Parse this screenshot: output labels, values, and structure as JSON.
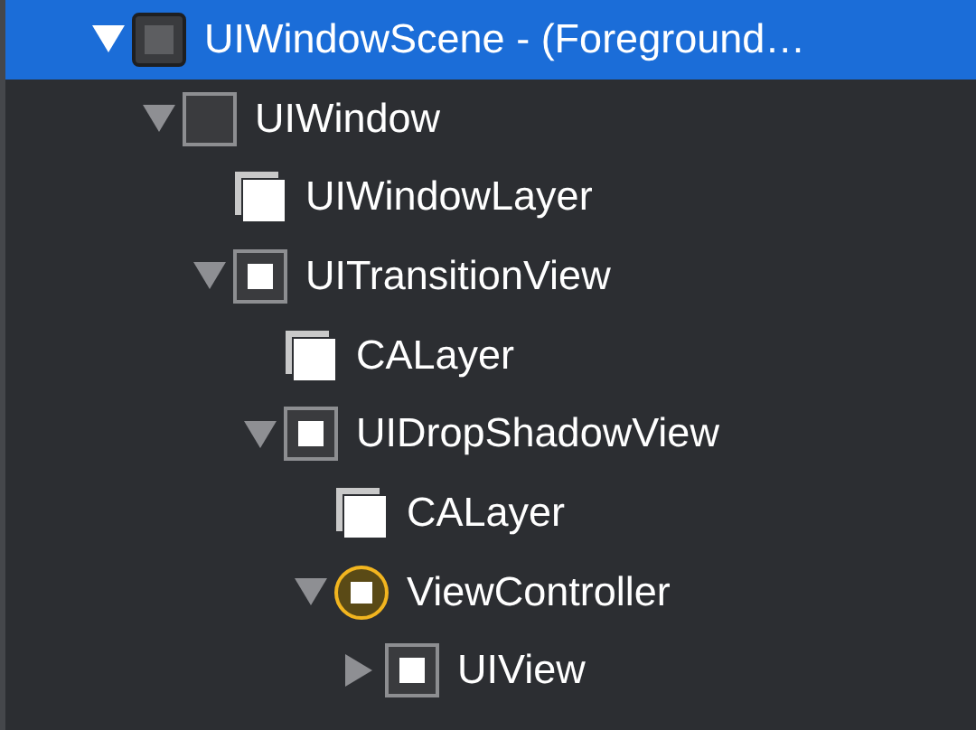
{
  "tree": [
    {
      "label": "UIWindowScene - (Foreground…",
      "kind": "scene",
      "expanded": true,
      "selected": true,
      "children": [
        {
          "label": "UIWindow",
          "kind": "window",
          "expanded": true,
          "selected": false,
          "children": [
            {
              "label": "UIWindowLayer",
              "kind": "layer",
              "selected": false
            },
            {
              "label": "UITransitionView",
              "kind": "view",
              "expanded": true,
              "selected": false,
              "children": [
                {
                  "label": "CALayer",
                  "kind": "layer",
                  "selected": false
                },
                {
                  "label": "UIDropShadowView",
                  "kind": "view",
                  "expanded": true,
                  "selected": false,
                  "children": [
                    {
                      "label": "CALayer",
                      "kind": "layer",
                      "selected": false
                    },
                    {
                      "label": "ViewController",
                      "kind": "controller",
                      "expanded": true,
                      "selected": false,
                      "children": [
                        {
                          "label": "UIView",
                          "kind": "view",
                          "expanded": false,
                          "selected": false
                        }
                      ]
                    }
                  ]
                }
              ]
            }
          ]
        }
      ]
    }
  ]
}
